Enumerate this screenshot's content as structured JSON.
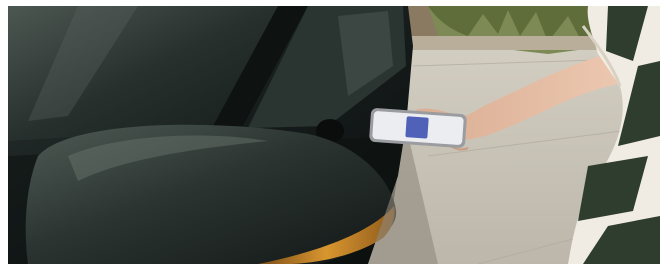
{
  "scene": {
    "car_color": "#1b2321",
    "trim_accent": "#c98a2a",
    "ground_color": "#c9c4b9",
    "plant_color": "#6c7a45",
    "skin_color": "#e2b9a0",
    "shirt_pattern": [
      "#f1ece3",
      "#2e3d2e"
    ],
    "phone_screen_color": "#5062b8"
  }
}
